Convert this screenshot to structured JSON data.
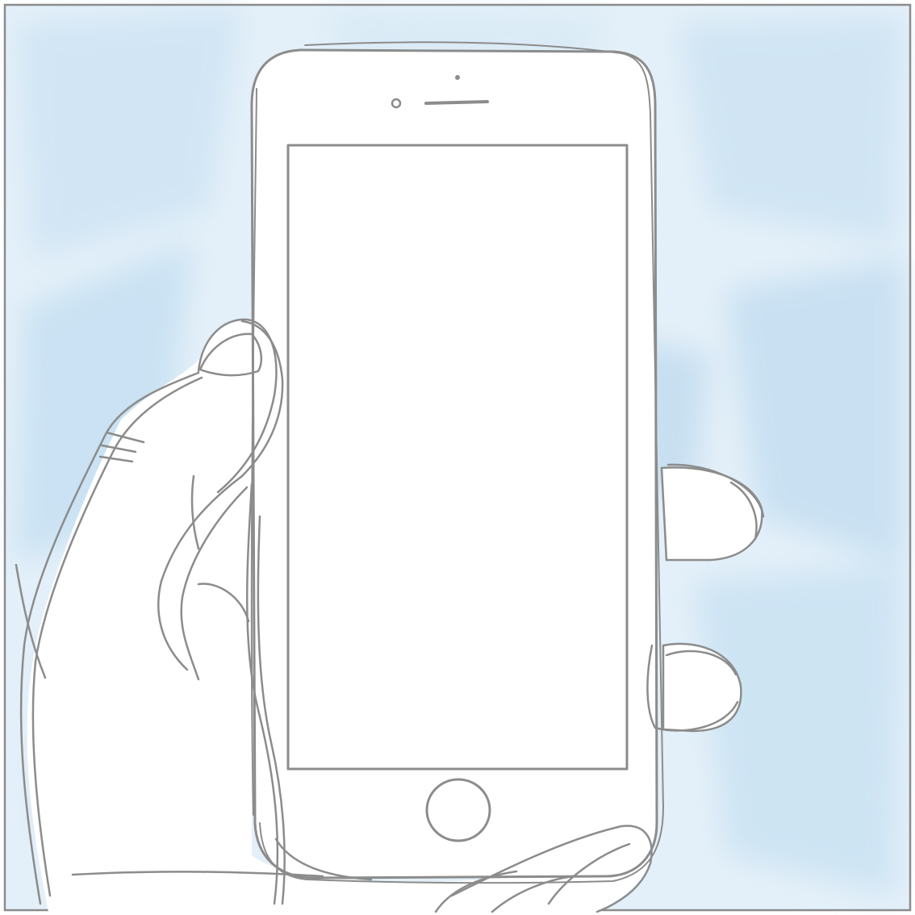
{
  "illustration": {
    "subject": "hand-holding-smartphone",
    "style": "pencil-sketch-over-watercolor",
    "colors": {
      "line": "#8c8c8c",
      "background_wash": "#d6e9f6",
      "background_wash_deep": "#b9d9ef",
      "paper": "#ffffff",
      "screen": "#ffffff"
    }
  }
}
